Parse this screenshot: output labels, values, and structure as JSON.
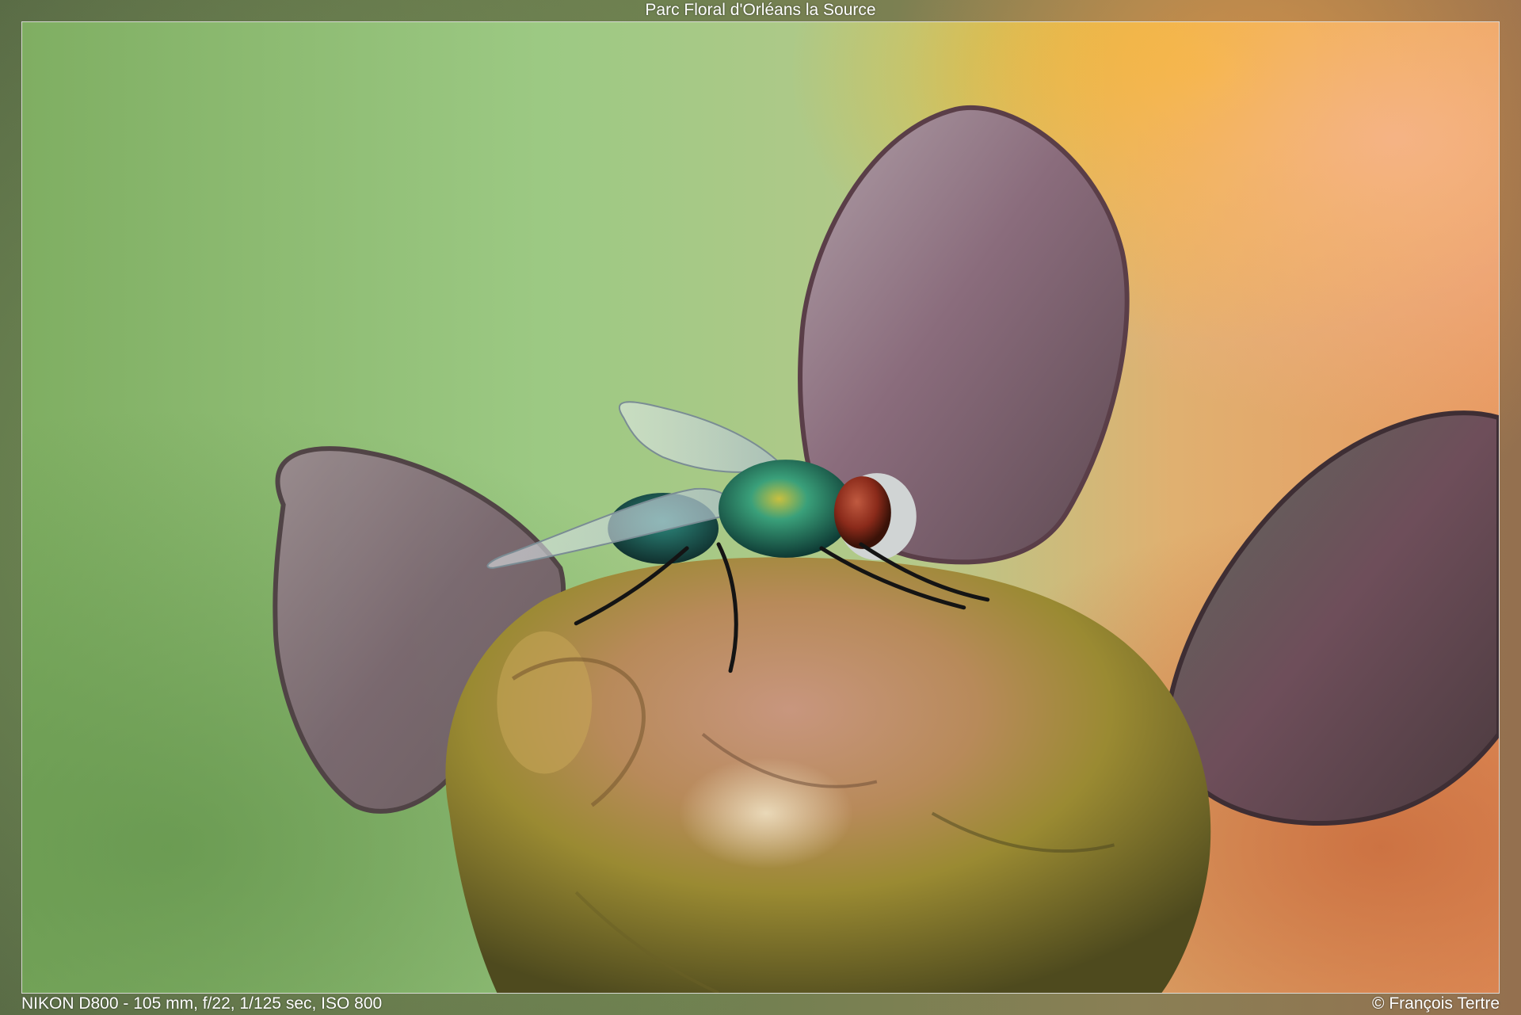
{
  "captions": {
    "title": "Parc Floral d'Orléans la Source",
    "exif": "NIKON D800 - 105 mm, f/22, 1/125 sec, ISO 800",
    "copyright": "© François Tertre"
  },
  "colors": {
    "background_green": "#8fbf78",
    "background_orange": "#f2a060",
    "background_yellow": "#f5b520",
    "petal_purple": "#8a6878",
    "bud_yellow": "#a89238",
    "fly_green": "#1f8a6a",
    "fly_eye": "#8a2a1a"
  }
}
